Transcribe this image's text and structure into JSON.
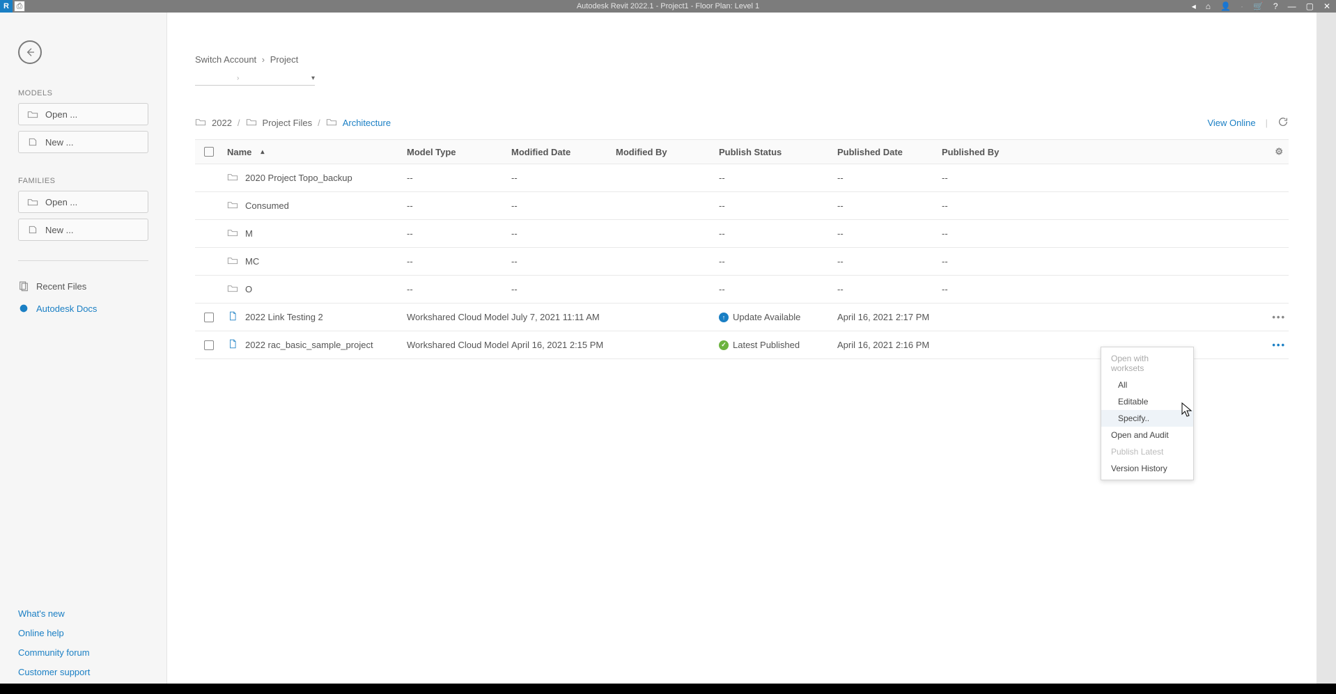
{
  "titlebar": {
    "title": "Autodesk Revit 2022.1 - Project1 - Floor Plan: Level 1"
  },
  "sidebar": {
    "models_label": "MODELS",
    "models_open": "Open ...",
    "models_new": "New ...",
    "families_label": "FAMILIES",
    "families_open": "Open ...",
    "families_new": "New ...",
    "recent_files": "Recent Files",
    "autodesk_docs": "Autodesk Docs",
    "links": {
      "whats_new": "What's new",
      "online_help": "Online help",
      "community_forum": "Community forum",
      "customer_support": "Customer support"
    }
  },
  "breadcrumb": {
    "switch_account": "Switch Account",
    "project": "Project"
  },
  "path": {
    "lvl1": "2022",
    "lvl2": "Project Files",
    "lvl3": "Architecture",
    "view_online": "View Online"
  },
  "columns": {
    "name": "Name",
    "model_type": "Model Type",
    "modified_date": "Modified Date",
    "modified_by": "Modified By",
    "publish_status": "Publish Status",
    "published_date": "Published Date",
    "published_by": "Published By"
  },
  "rows": [
    {
      "name": "2020 Project Topo_backup",
      "type": "folder",
      "model_type": "--",
      "modified_date": "--",
      "modified_by": "",
      "publish_status": "--",
      "published_date": "--",
      "published_by": "--"
    },
    {
      "name": "Consumed",
      "type": "folder",
      "model_type": "--",
      "modified_date": "--",
      "modified_by": "",
      "publish_status": "--",
      "published_date": "--",
      "published_by": "--"
    },
    {
      "name": "M",
      "type": "folder",
      "model_type": "--",
      "modified_date": "--",
      "modified_by": "",
      "publish_status": "--",
      "published_date": "--",
      "published_by": "--"
    },
    {
      "name": "MC",
      "type": "folder",
      "model_type": "--",
      "modified_date": "--",
      "modified_by": "",
      "publish_status": "--",
      "published_date": "--",
      "published_by": "--"
    },
    {
      "name": "O",
      "type": "folder",
      "model_type": "--",
      "modified_date": "--",
      "modified_by": "",
      "publish_status": "--",
      "published_date": "--",
      "published_by": "--"
    },
    {
      "name": "2022 Link Testing 2",
      "type": "rvt",
      "model_type": "Workshared Cloud Model",
      "modified_date": "July 7, 2021 11:11 AM",
      "modified_by": "",
      "publish_status": "Update Available",
      "status_kind": "update",
      "published_date": "April 16, 2021 2:17 PM",
      "published_by": ""
    },
    {
      "name": "2022 rac_basic_sample_project",
      "type": "rvt",
      "model_type": "Workshared Cloud Model",
      "modified_date": "April 16, 2021 2:15 PM",
      "modified_by": "",
      "publish_status": "Latest Published",
      "status_kind": "latest",
      "published_date": "April 16, 2021 2:16 PM",
      "published_by": ""
    }
  ],
  "context_menu": {
    "header": "Open with worksets",
    "all": "All",
    "editable": "Editable",
    "specify": "Specify..",
    "open_audit": "Open and Audit",
    "publish_latest": "Publish Latest",
    "version_history": "Version History"
  }
}
